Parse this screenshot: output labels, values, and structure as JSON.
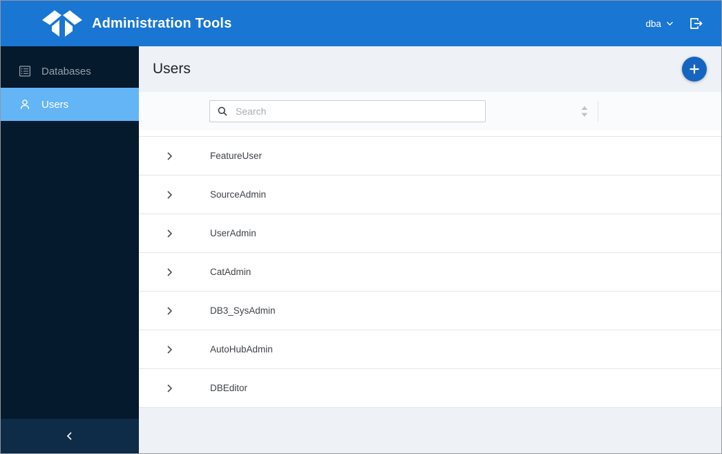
{
  "topbar": {
    "title": "Administration Tools",
    "logo_icon": "teradata-logo",
    "user_menu_label": "dba",
    "user_menu_icon": "chevron-down-icon",
    "logout_icon": "logout-icon"
  },
  "sidebar": {
    "items": [
      {
        "label": "Databases",
        "icon": "databases-icon",
        "selected": false
      },
      {
        "label": "Users",
        "icon": "users-icon",
        "selected": true
      }
    ],
    "collapse_icon": "chevron-left-icon"
  },
  "main": {
    "page_title": "Users",
    "add_button_icon": "plus-icon",
    "toolbar": {
      "search_placeholder": "Search",
      "sort_icon": "sort-icon"
    },
    "row_expander_icon": "chevron-right-icon",
    "users": [
      {
        "name": "FeatureUser"
      },
      {
        "name": "SourceAdmin"
      },
      {
        "name": "UserAdmin"
      },
      {
        "name": "CatAdmin"
      },
      {
        "name": "DB3_SysAdmin"
      },
      {
        "name": "AutoHubAdmin"
      },
      {
        "name": "DBEditor"
      }
    ]
  },
  "colors": {
    "topbar_blue": "#1976d2",
    "fab_blue": "#1565c0",
    "sidebar_navy": "#051a2d",
    "sidebar_footer_navy": "#0e2b48",
    "selected_item_blue": "#64b5f6",
    "page_background": "#eef1f5",
    "toolbar_background": "#fafbfc"
  }
}
